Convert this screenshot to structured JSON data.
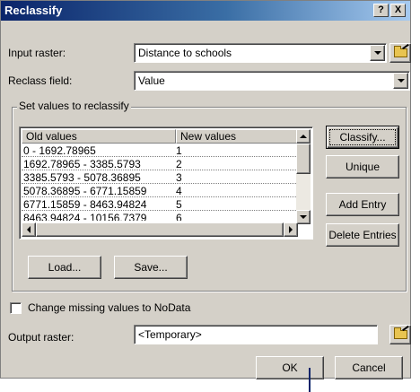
{
  "window": {
    "title": "Reclassify",
    "help_label": "?",
    "close_label": "X"
  },
  "input_raster": {
    "label": "Input raster:",
    "value": "Distance to schools"
  },
  "reclass_field": {
    "label": "Reclass field:",
    "value": "Value"
  },
  "reclass_group": {
    "title": "Set values to reclassify",
    "columns": [
      "Old values",
      "New values"
    ],
    "rows": [
      {
        "old": "0 - 1692.78965",
        "new": "1"
      },
      {
        "old": "1692.78965 - 3385.5793",
        "new": "2"
      },
      {
        "old": "3385.5793 - 5078.36895",
        "new": "3"
      },
      {
        "old": "5078.36895 - 6771.15859",
        "new": "4"
      },
      {
        "old": "6771.15859 - 8463.94824",
        "new": "5"
      },
      {
        "old": "8463.94824 - 10156.7379",
        "new": "6"
      }
    ],
    "buttons": {
      "classify": "Classify...",
      "unique": "Unique",
      "add_entry": "Add Entry",
      "delete_entries": "Delete Entries",
      "load": "Load...",
      "save": "Save..."
    }
  },
  "missing_values": {
    "label": "Change missing values to NoData",
    "checked": false
  },
  "output_raster": {
    "label": "Output raster:",
    "value": "<Temporary>"
  },
  "footer": {
    "ok": "OK",
    "cancel": "Cancel"
  },
  "colors": {
    "title_bar": "#0a246a",
    "dialog_bg": "#d4d0c8",
    "field_bg": "#ffffff"
  },
  "icons": [
    "help-icon",
    "close-icon",
    "dropdown-arrow-icon",
    "open-folder-icon",
    "scroll-up-icon",
    "scroll-down-icon",
    "scroll-left-icon",
    "scroll-right-icon"
  ]
}
